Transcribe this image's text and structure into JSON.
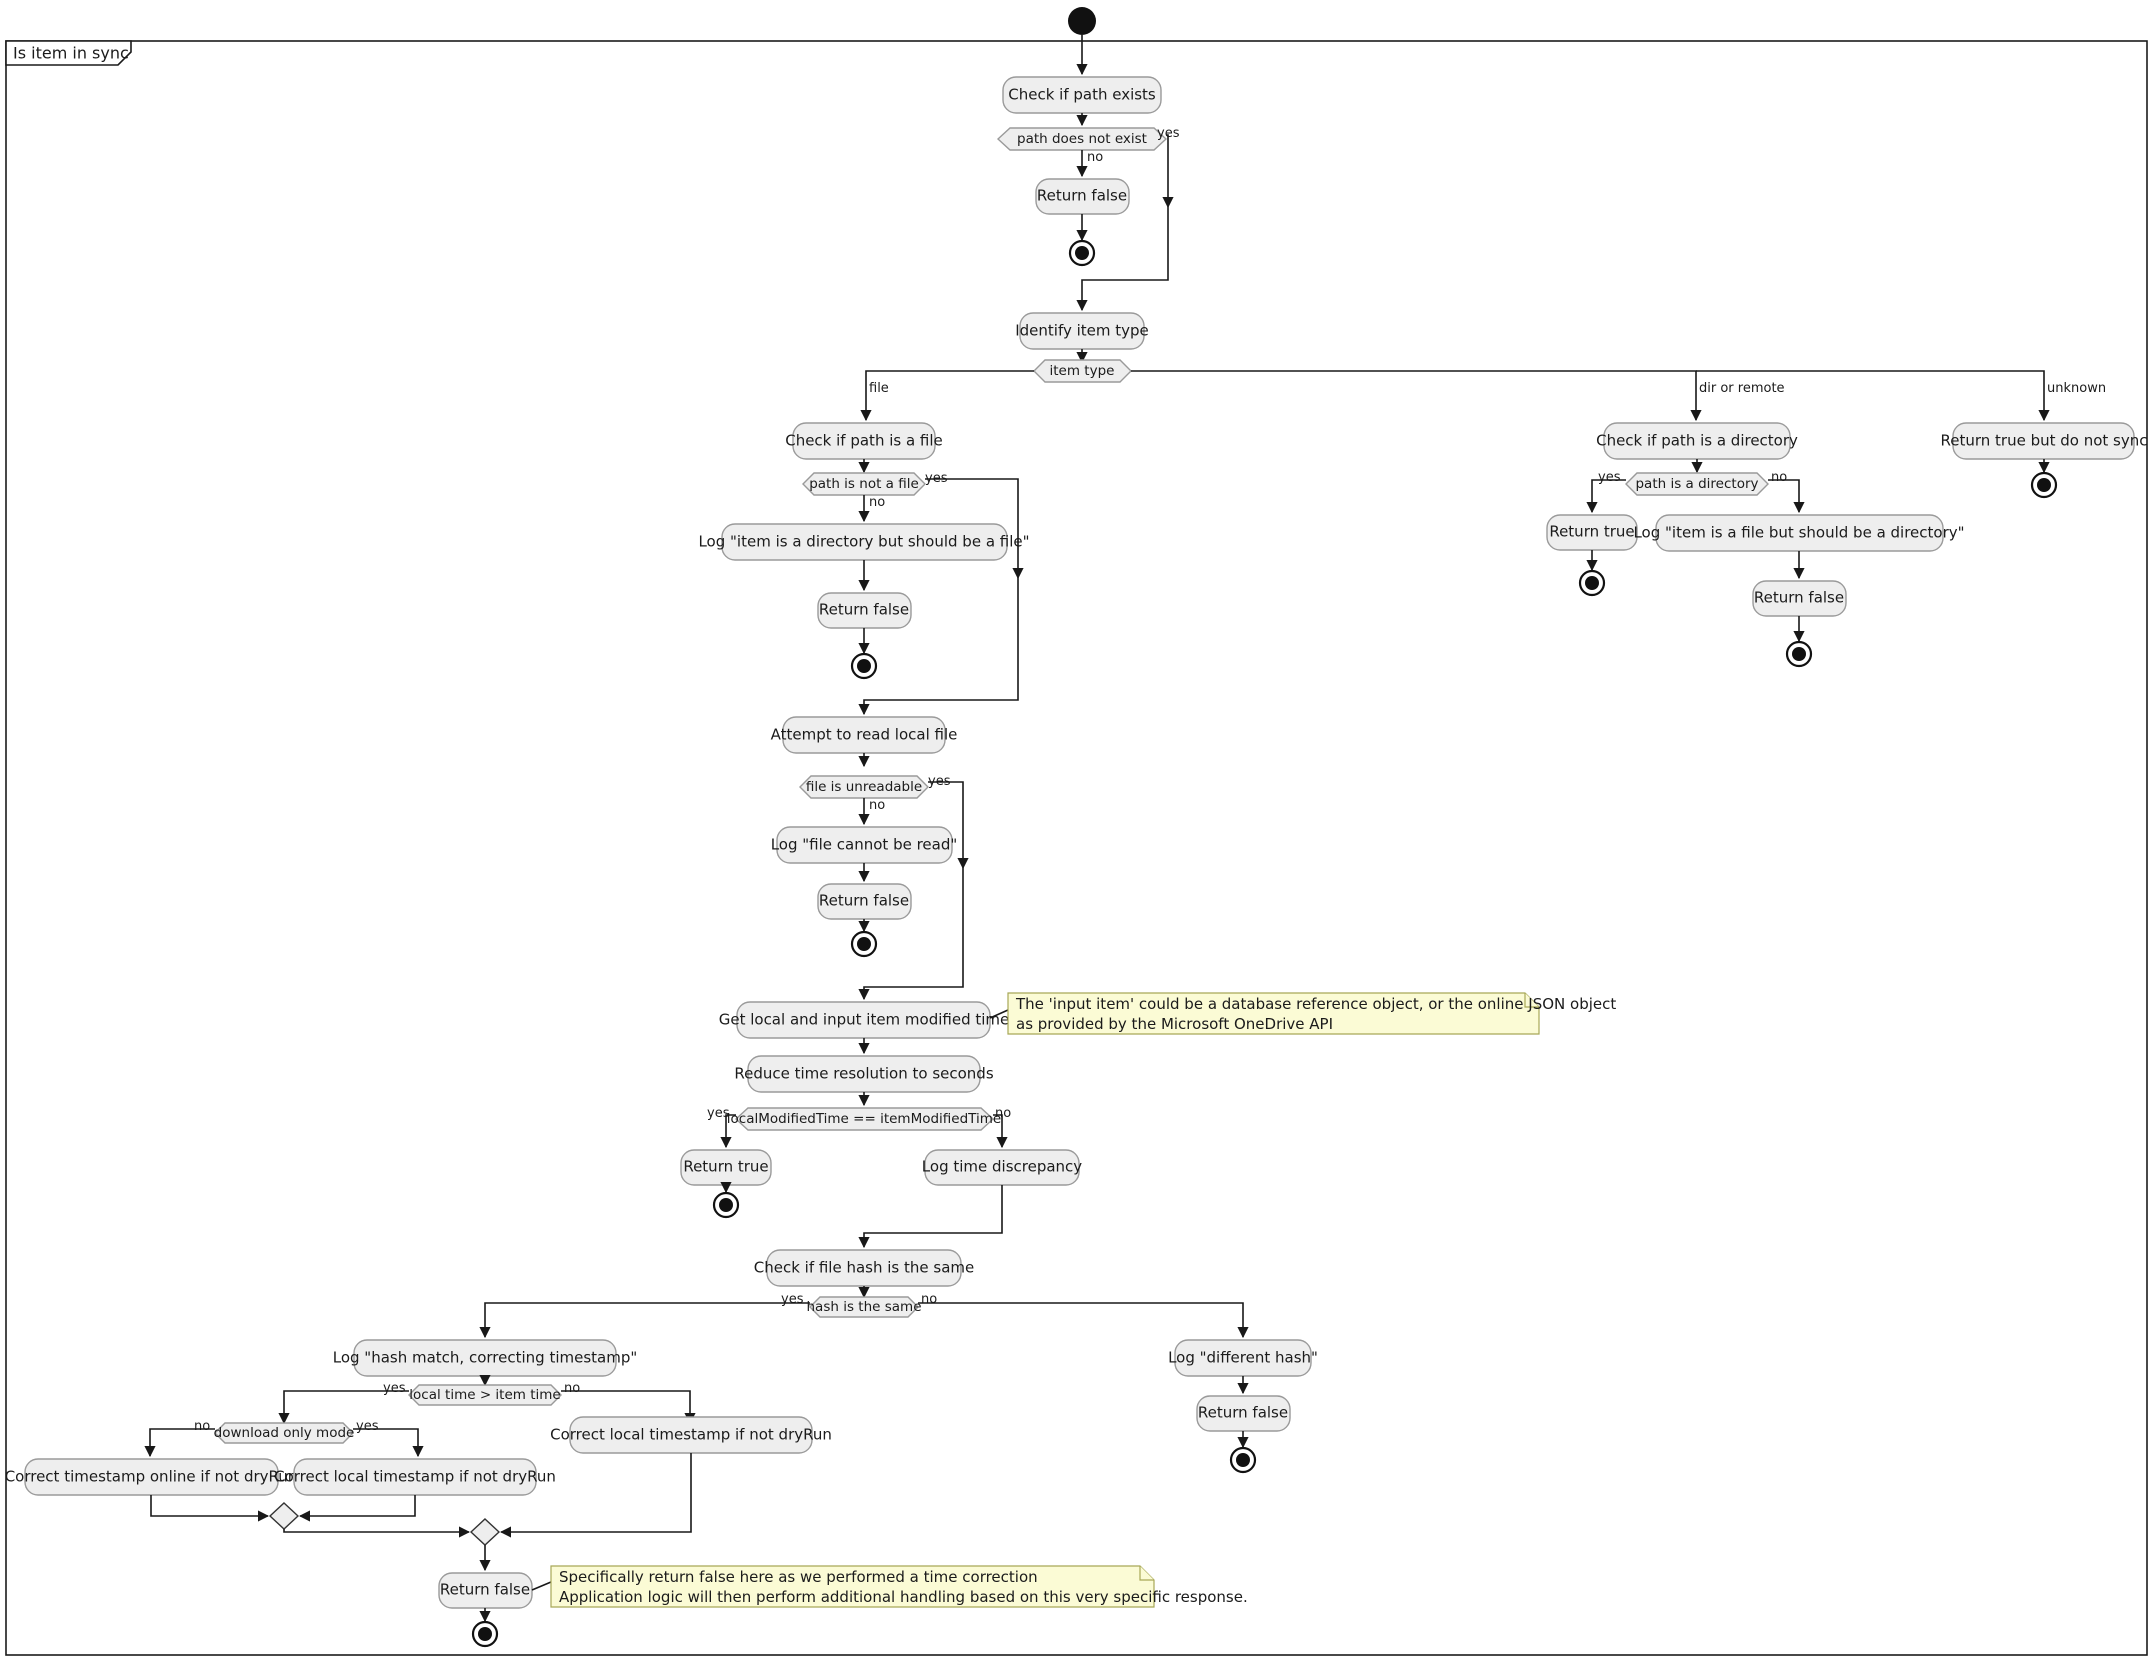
{
  "diagram": {
    "type": "uml-activity-diagram",
    "frame_label": "Is item in sync",
    "colors": {
      "activity_fill": "#EEEEEE",
      "activity_stroke": "#9A9A9A",
      "note_fill": "#FBFBD5",
      "note_stroke": "#A8A857",
      "edge": "#181818",
      "text": "#1B1B1B",
      "background": "#FFFFFF"
    },
    "activities": {
      "check_path_exists": "Check if path exists",
      "return_false_1": "Return false",
      "identify_item_type": "Identify item type",
      "check_path_is_file": "Check if path is a file",
      "log_dir_should_be_file": "Log \"item is a directory but should be a file\"",
      "return_false_2": "Return false",
      "attempt_read_local_file": "Attempt to read local file",
      "log_file_cannot_be_read": "Log \"file cannot be read\"",
      "return_false_3": "Return false",
      "get_modified_time": "Get local and input item modified time",
      "reduce_time_resolution": "Reduce time resolution to seconds",
      "return_true_1": "Return true",
      "log_time_discrepancy": "Log time discrepancy",
      "check_file_hash": "Check if file hash is the same",
      "log_hash_match": "Log \"hash match, correcting timestamp\"",
      "correct_timestamp_online": "Correct timestamp online if not dryRun",
      "correct_local_timestamp_a": "Correct local timestamp if not dryRun",
      "correct_local_timestamp_b": "Correct local timestamp if not dryRun",
      "return_false_final": "Return false",
      "log_different_hash": "Log \"different hash\"",
      "return_false_4": "Return false",
      "check_path_is_directory": "Check if path is a directory",
      "return_true_2": "Return true",
      "log_file_should_be_dir": "Log \"item is a file but should be a directory\"",
      "return_false_5": "Return false",
      "return_true_no_sync": "Return true but do not sync"
    },
    "decisions": {
      "path_does_not_exist": "path does not exist",
      "item_type": "item type",
      "path_is_not_a_file": "path is not a file",
      "file_is_unreadable": "file is unreadable",
      "time_equal": "localModifiedTime == itemModifiedTime",
      "hash_is_the_same": "hash is the same",
      "local_time_gt_item_time": "local time > item time",
      "download_only_mode": "download only mode",
      "path_is_a_directory": "path is a directory"
    },
    "branch_labels": {
      "path_not_exist_yes": "yes",
      "path_not_exist_no": "no",
      "item_type_file": "file",
      "item_type_dir_remote": "dir or remote",
      "item_type_unknown": "unknown",
      "not_a_file_yes": "yes",
      "not_a_file_no": "no",
      "unreadable_yes": "yes",
      "unreadable_no": "no",
      "time_equal_yes": "yes",
      "time_equal_no": "no",
      "hash_same_yes": "yes",
      "hash_same_no": "no",
      "local_gt_yes": "yes",
      "local_gt_no": "no",
      "download_only_no": "no",
      "download_only_yes": "yes",
      "is_dir_yes": "yes",
      "is_dir_no": "no"
    },
    "notes": {
      "input_item_note": {
        "line1": "The 'input item' could be a database reference object, or the online JSON object",
        "line2": "as provided by the Microsoft OneDrive API"
      },
      "return_false_note": {
        "line1": "Specifically return false here as we performed a time correction",
        "line2": "Application logic will then perform additional handling based on this very specific response."
      }
    }
  }
}
